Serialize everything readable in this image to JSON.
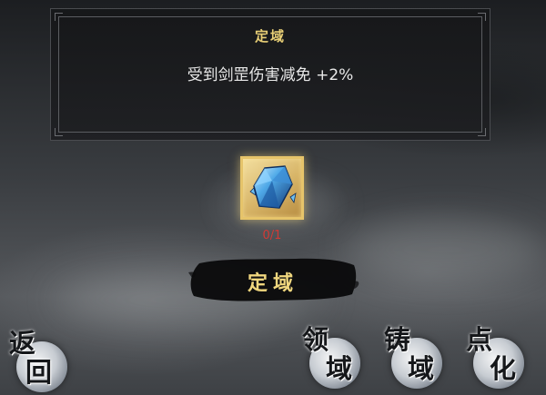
{
  "info_panel": {
    "title": "定域",
    "effect": "受到剑罡伤害减免 +2%"
  },
  "item": {
    "icon": "blue-crystal-icon",
    "count": "0/1"
  },
  "confirm_button": {
    "label": "定域"
  },
  "bottom_nav": {
    "back": {
      "char1": "返",
      "char2": "回"
    },
    "lingyu": {
      "char1": "领",
      "char2": "域"
    },
    "zhuyu": {
      "char1": "铸",
      "char2": "域"
    },
    "dianhua": {
      "char1": "点",
      "char2": "化"
    }
  },
  "colors": {
    "title_gold": "#e8cf76",
    "count_red": "#d23a35",
    "slot_gold": "#e6c46a"
  }
}
